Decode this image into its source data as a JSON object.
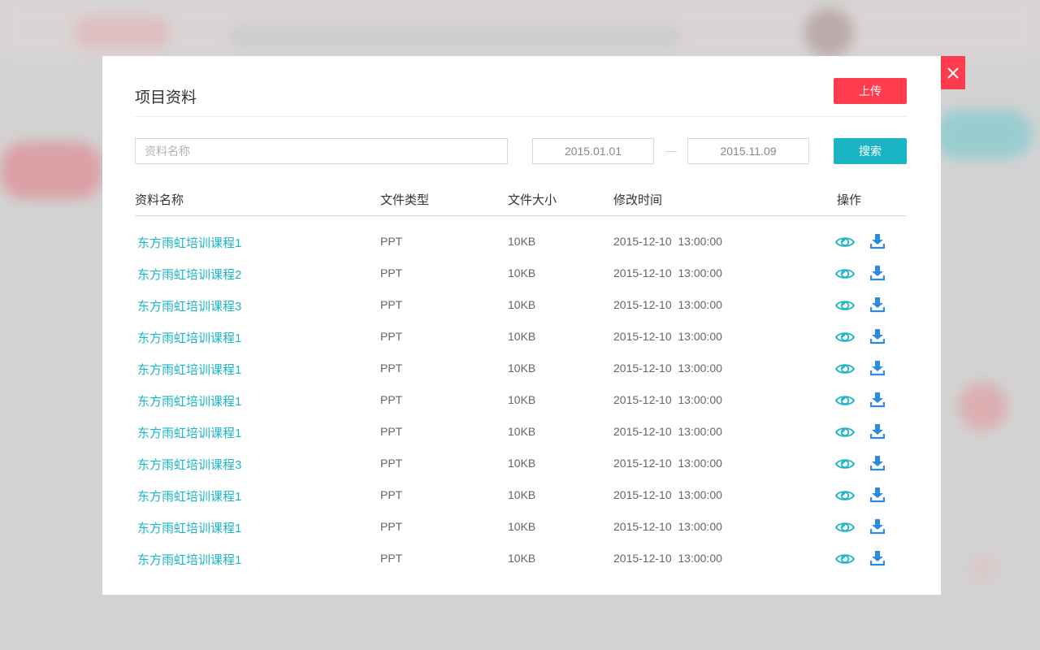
{
  "colors": {
    "accent_teal": "#1ab5c5",
    "upload_red": "#ff3b4d",
    "close_red": "#ff3b4d",
    "download_blue": "#2b8be0"
  },
  "modal": {
    "title": "项目资料",
    "upload_label": "上传",
    "close_icon": "close-icon"
  },
  "filter": {
    "name_placeholder": "资料名称",
    "start_date": "2015.01.01",
    "date_separator": "—",
    "end_date": "2015.11.09",
    "search_label": "搜索"
  },
  "table": {
    "headers": {
      "name": "资料名称",
      "type": "文件类型",
      "size": "文件大小",
      "time": "修改时间",
      "ops": "操作"
    },
    "rows": [
      {
        "name": "东方雨虹培训课程1",
        "type": "PPT",
        "size": "10KB",
        "time": "2015-12-10  13:00:00"
      },
      {
        "name": "东方雨虹培训课程2",
        "type": "PPT",
        "size": "10KB",
        "time": "2015-12-10  13:00:00"
      },
      {
        "name": "东方雨虹培训课程3",
        "type": "PPT",
        "size": "10KB",
        "time": "2015-12-10  13:00:00"
      },
      {
        "name": "东方雨虹培训课程1",
        "type": "PPT",
        "size": "10KB",
        "time": "2015-12-10  13:00:00"
      },
      {
        "name": "东方雨虹培训课程1",
        "type": "PPT",
        "size": "10KB",
        "time": "2015-12-10  13:00:00"
      },
      {
        "name": "东方雨虹培训课程1",
        "type": "PPT",
        "size": "10KB",
        "time": "2015-12-10  13:00:00"
      },
      {
        "name": "东方雨虹培训课程1",
        "type": "PPT",
        "size": "10KB",
        "time": "2015-12-10  13:00:00"
      },
      {
        "name": "东方雨虹培训课程3",
        "type": "PPT",
        "size": "10KB",
        "time": "2015-12-10  13:00:00"
      },
      {
        "name": "东方雨虹培训课程1",
        "type": "PPT",
        "size": "10KB",
        "time": "2015-12-10  13:00:00"
      },
      {
        "name": "东方雨虹培训课程1",
        "type": "PPT",
        "size": "10KB",
        "time": "2015-12-10  13:00:00"
      },
      {
        "name": "东方雨虹培训课程1",
        "type": "PPT",
        "size": "10KB",
        "time": "2015-12-10  13:00:00"
      }
    ],
    "row_icons": [
      "eye-icon",
      "download-icon"
    ]
  }
}
